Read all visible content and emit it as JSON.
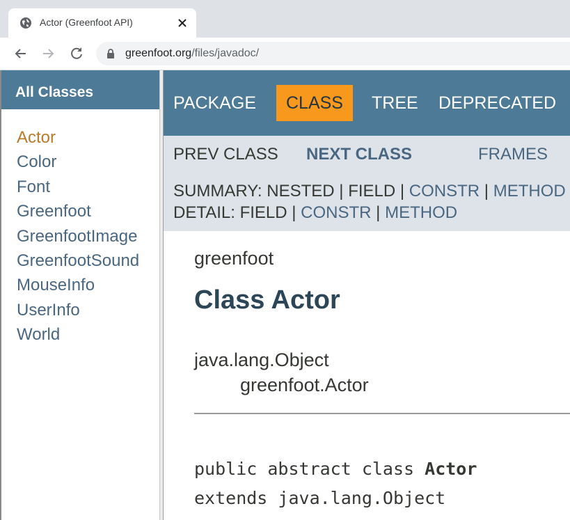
{
  "browser": {
    "tab_title": "Actor (Greenfoot API)",
    "url_host": "greenfoot.org",
    "url_path": "/files/javadoc/",
    "icons": {
      "favicon": "globe-icon",
      "close": "close-icon",
      "back": "back-arrow-icon",
      "forward": "forward-arrow-icon",
      "reload": "reload-icon",
      "lock": "lock-icon"
    }
  },
  "left_frame": {
    "title": "All Classes",
    "classes": [
      {
        "label": "Actor",
        "active": true
      },
      {
        "label": "Color"
      },
      {
        "label": "Font"
      },
      {
        "label": "Greenfoot"
      },
      {
        "label": "GreenfootImage"
      },
      {
        "label": "GreenfootSound"
      },
      {
        "label": "MouseInfo"
      },
      {
        "label": "UserInfo"
      },
      {
        "label": "World"
      }
    ]
  },
  "topnav": {
    "package": "PACKAGE",
    "class": "CLASS",
    "tree": "TREE",
    "deprecated": "DEPRECATED"
  },
  "subnav": {
    "prev_class": "PREV CLASS",
    "next_class": "NEXT CLASS",
    "frames": "FRAMES",
    "summary_label": "SUMMARY: ",
    "summary_nested": "NESTED",
    "summary_field": "FIELD",
    "summary_constr": "CONSTR",
    "summary_method": "METHOD",
    "detail_label": "DETAIL: ",
    "detail_field": "FIELD",
    "detail_constr": "CONSTR",
    "detail_method": "METHOD",
    "separator": " | "
  },
  "content": {
    "package_name": "greenfoot",
    "class_title": "Class Actor",
    "inheritance_root": "java.lang.Object",
    "inheritance_child": "greenfoot.Actor",
    "decl_prefix": "public abstract class ",
    "decl_name": "Actor",
    "decl_extends": "extends java.lang.Object"
  },
  "colors": {
    "header_blue": "#4d7a97",
    "selected_orange": "#f8981d",
    "subnav_gray": "#dee3e9",
    "link_blue": "#4a6782",
    "active_link": "#bb7a2a"
  }
}
